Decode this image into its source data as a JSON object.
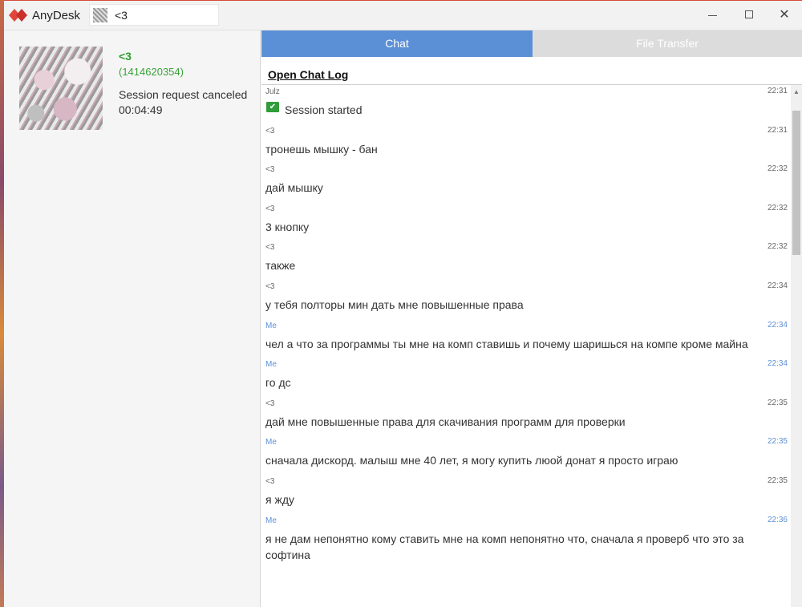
{
  "app": {
    "title": "AnyDesk",
    "brand_color": "#e0463a",
    "accent_color": "#5b8fd6"
  },
  "address_bar": {
    "value": "<3"
  },
  "window_controls": {
    "minimize": "minimize-icon",
    "maximize": "maximize-icon",
    "close": "✕"
  },
  "contact": {
    "name": "<3",
    "id": "(1414620354)",
    "status": "Session request canceled",
    "duration": "00:04:49"
  },
  "tabs": [
    {
      "label": "Chat",
      "active": true
    },
    {
      "label": "File Transfer",
      "active": false
    }
  ],
  "chat": {
    "open_log_label": "Open Chat Log",
    "messages": [
      {
        "sender": "Julz",
        "time": "22:31",
        "text": "Session started",
        "type": "system"
      },
      {
        "sender": "<3",
        "time": "22:31",
        "text": "тронешь  мышку - бан",
        "type": "remote"
      },
      {
        "sender": "<3",
        "time": "22:32",
        "text": "дай мышку",
        "type": "remote"
      },
      {
        "sender": "<3",
        "time": "22:32",
        "text": "3 кнопку",
        "type": "remote"
      },
      {
        "sender": "<3",
        "time": "22:32",
        "text": "также",
        "type": "remote"
      },
      {
        "sender": "<3",
        "time": "22:34",
        "text": "у тебя полторы мин дать мне повышенные права",
        "type": "remote"
      },
      {
        "sender": "Me",
        "time": "22:34",
        "text": "чел а что за программы ты мне на комп ставишь и почему шаришься на компе кроме майна",
        "type": "me"
      },
      {
        "sender": "Me",
        "time": "22:34",
        "text": "го дс",
        "type": "me"
      },
      {
        "sender": "<3",
        "time": "22:35",
        "text": "дай мне повышенные права для скачивания программ для проверки",
        "type": "remote"
      },
      {
        "sender": "Me",
        "time": "22:35",
        "text": "сначала дискорд. малыш мне 40 лет, я могу купить люой донат я просто играю",
        "type": "me"
      },
      {
        "sender": "<3",
        "time": "22:35",
        "text": "я жду",
        "type": "remote"
      },
      {
        "sender": "Me",
        "time": "22:36",
        "text": "я не дам непонятно кому ставить мне на комп непонятно что, сначала я проверб что это за софтина",
        "type": "me"
      }
    ]
  }
}
